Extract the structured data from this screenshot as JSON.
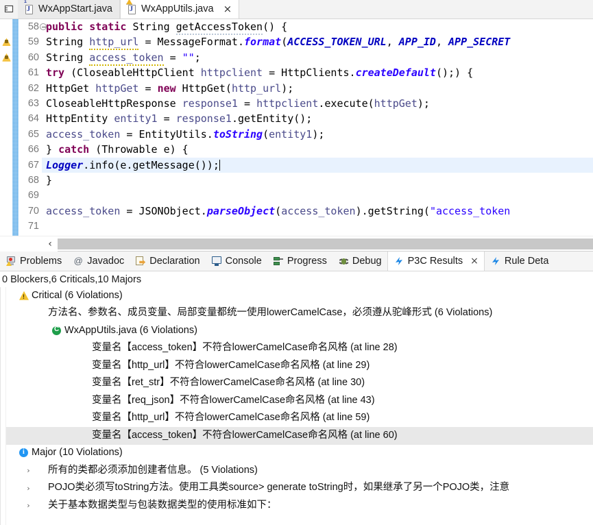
{
  "editor": {
    "tabs": [
      {
        "label": "WxAppStart.java",
        "icon": "java-file-icon",
        "active": false,
        "closable": false,
        "warning": false
      },
      {
        "label": "WxAppUtils.java",
        "icon": "java-file-icon",
        "active": true,
        "closable": true,
        "warning": true
      }
    ],
    "close_glyph": "×",
    "view_menu_icon": "view-menu-icon",
    "scroll_left_glyph": "‹",
    "lines": [
      {
        "num": "58",
        "marker": "none",
        "fold": true,
        "highlight": false
      },
      {
        "num": "59",
        "marker": "warning",
        "fold": false,
        "highlight": false
      },
      {
        "num": "60",
        "marker": "warning",
        "fold": false,
        "highlight": false
      },
      {
        "num": "61",
        "marker": "none",
        "fold": false,
        "highlight": false
      },
      {
        "num": "62",
        "marker": "none",
        "fold": false,
        "highlight": false
      },
      {
        "num": "63",
        "marker": "none",
        "fold": false,
        "highlight": false
      },
      {
        "num": "64",
        "marker": "none",
        "fold": false,
        "highlight": false
      },
      {
        "num": "65",
        "marker": "none",
        "fold": false,
        "highlight": false
      },
      {
        "num": "66",
        "marker": "none",
        "fold": false,
        "highlight": false
      },
      {
        "num": "67",
        "marker": "none",
        "fold": false,
        "highlight": true
      },
      {
        "num": "68",
        "marker": "none",
        "fold": false,
        "highlight": false
      },
      {
        "num": "69",
        "marker": "none",
        "fold": false,
        "highlight": false
      },
      {
        "num": "70",
        "marker": "none",
        "fold": false,
        "highlight": false
      },
      {
        "num": "71",
        "marker": "none",
        "fold": false,
        "highlight": false
      }
    ],
    "code": {
      "l58": "    public static String getAccessToken() {",
      "l59": "        String http_url = MessageFormat.format(ACCESS_TOKEN_URL, APP_ID, APP_SECRET",
      "l60": "        String access_token = \"\";",
      "l61": "        try (CloseableHttpClient httpclient = HttpClients.createDefault();) {",
      "l62": "            HttpGet httpGet = new HttpGet(http_url);",
      "l63": "            CloseableHttpResponse response1 = httpclient.execute(httpGet);",
      "l64": "            HttpEntity entity1 = response1.getEntity();",
      "l65": "            access_token = EntityUtils.toString(entity1);",
      "l66": "        } catch (Throwable e) {",
      "l67": "            Logger.info(e.getMessage());",
      "l68": "        }",
      "l69": "",
      "l70": "        access_token = JSONObject.parseObject(access_token).getString(\"access_token",
      "l71": ""
    }
  },
  "bottom_view": {
    "tabs": [
      {
        "label": "Problems",
        "icon": "problems-icon",
        "active": false,
        "closable": false
      },
      {
        "label": "Javadoc",
        "icon": "javadoc-icon",
        "active": false,
        "closable": false
      },
      {
        "label": "Declaration",
        "icon": "declaration-icon",
        "active": false,
        "closable": false
      },
      {
        "label": "Console",
        "icon": "console-icon",
        "active": false,
        "closable": false
      },
      {
        "label": "Progress",
        "icon": "progress-icon",
        "active": false,
        "closable": false
      },
      {
        "label": "Debug",
        "icon": "debug-icon",
        "active": false,
        "closable": false
      },
      {
        "label": "P3C Results",
        "icon": "p3c-icon",
        "active": true,
        "closable": true
      },
      {
        "label": "Rule Deta",
        "icon": "p3c-icon",
        "active": false,
        "closable": false
      }
    ],
    "close_glyph": "×",
    "summary": "0 Blockers,6 Criticals,10 Majors",
    "tree": [
      {
        "id": "critical",
        "label": "Critical (6 Violations)",
        "icon": "warning-triangle-icon",
        "twisty": "expanded",
        "indent": 1,
        "selected": false
      },
      {
        "id": "critical-rule-1",
        "label": "方法名、参数名、成员变量、局部变量都统一使用lowerCamelCase，必须遵从驼峰形式 (6 Violations)",
        "icon": "none",
        "twisty": "expanded",
        "indent": 2,
        "selected": false
      },
      {
        "id": "critical-file-1",
        "label": "WxAppUtils.java (6 Violations)",
        "icon": "java-class-icon",
        "twisty": "expanded",
        "indent": 3,
        "selected": false
      },
      {
        "id": "v1",
        "label": "变量名【access_token】不符合lowerCamelCase命名风格 (at line 28)",
        "icon": "none",
        "twisty": "none",
        "indent": 4,
        "selected": false
      },
      {
        "id": "v2",
        "label": "变量名【http_url】不符合lowerCamelCase命名风格 (at line 29)",
        "icon": "none",
        "twisty": "none",
        "indent": 4,
        "selected": false
      },
      {
        "id": "v3",
        "label": "变量名【ret_str】不符合lowerCamelCase命名风格 (at line 30)",
        "icon": "none",
        "twisty": "none",
        "indent": 4,
        "selected": false
      },
      {
        "id": "v4",
        "label": "变量名【req_json】不符合lowerCamelCase命名风格 (at line 43)",
        "icon": "none",
        "twisty": "none",
        "indent": 4,
        "selected": false
      },
      {
        "id": "v5",
        "label": "变量名【http_url】不符合lowerCamelCase命名风格 (at line 59)",
        "icon": "none",
        "twisty": "none",
        "indent": 4,
        "selected": false
      },
      {
        "id": "v6",
        "label": "变量名【access_token】不符合lowerCamelCase命名风格 (at line 60)",
        "icon": "none",
        "twisty": "none",
        "indent": 4,
        "selected": true
      },
      {
        "id": "major",
        "label": "Major (10 Violations)",
        "icon": "info-circle-icon",
        "twisty": "expanded",
        "indent": 1,
        "selected": false
      },
      {
        "id": "major-rule-1",
        "label": "所有的类都必须添加创建者信息。 (5 Violations)",
        "icon": "none",
        "twisty": "collapsed",
        "indent": 2,
        "selected": false
      },
      {
        "id": "major-rule-2",
        "label": "POJO类必须写toString方法。使用工具类source> generate toString时，如果继承了另一个POJO类，注意",
        "icon": "none",
        "twisty": "collapsed",
        "indent": 2,
        "selected": false
      },
      {
        "id": "major-rule-3",
        "label": "关于基本数据类型与包装数据类型的使用标准如下：",
        "icon": "none",
        "twisty": "collapsed",
        "indent": 2,
        "selected": false
      }
    ],
    "twisty_expanded_glyph": "ⱟ",
    "twisty_collapsed_glyph": "›"
  },
  "colors": {
    "change_bar": "#5babe8",
    "selection_highlight": "#e8f2fe",
    "tree_selected": "#e8e8e8",
    "keyword": "#7f0055",
    "string": "#2a00ff",
    "static_field": "#0000c0",
    "warning_yellow": "#f2c230",
    "info_blue": "#2196f3",
    "p3c_blue": "#1e88e5",
    "green_class": "#1e9e4a"
  }
}
